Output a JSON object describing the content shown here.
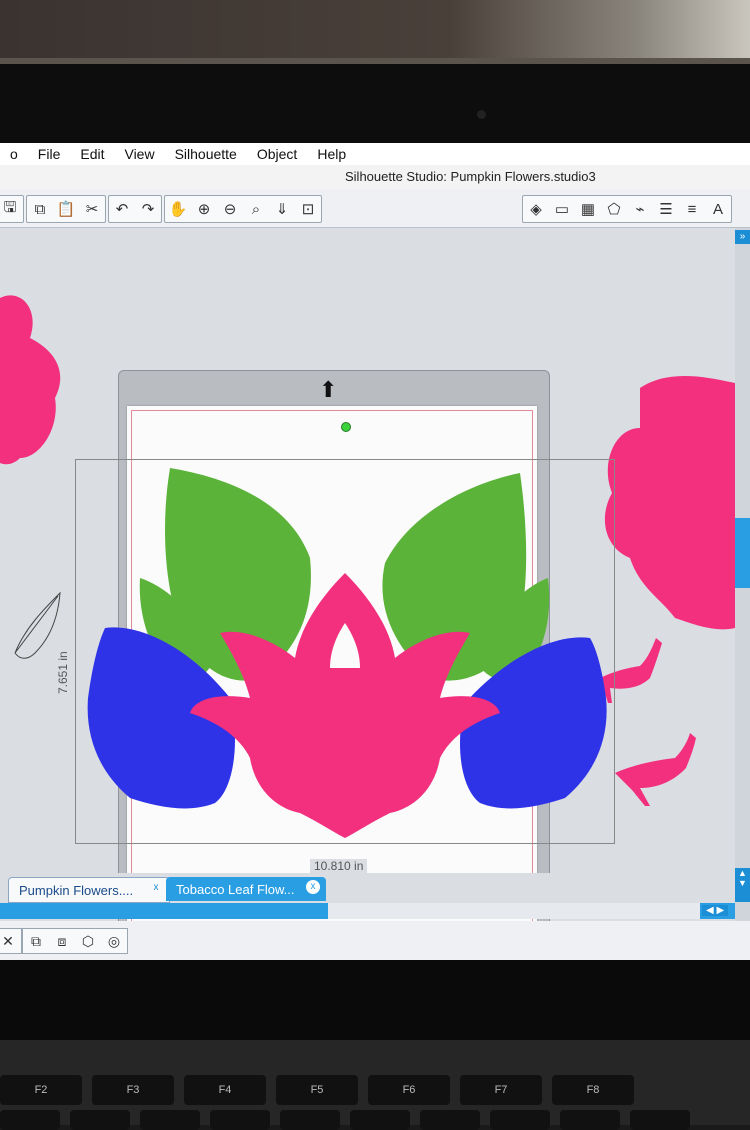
{
  "menu": [
    "o",
    "File",
    "Edit",
    "View",
    "Silhouette",
    "Object",
    "Help"
  ],
  "window_title": "Silhouette Studio: Pumpkin Flowers.studio3",
  "toolbar_left_icons": [
    "save-icon",
    "copy-icon",
    "paste-icon",
    "cut-icon",
    "undo-icon",
    "redo-icon",
    "pan-icon",
    "zoom-in-icon",
    "zoom-out-icon",
    "zoom-select-icon",
    "fit-page-icon",
    "zoom-fit-icon"
  ],
  "toolbar_left_glyphs": [
    "🖫",
    "⧉",
    "📋",
    "✂",
    "↶",
    "↷",
    "✋",
    "⊕",
    "⊖",
    "⌕",
    "⇓",
    "⊡"
  ],
  "toolbar_right_icons": [
    "fill-icon",
    "page-setup-icon",
    "grid-icon",
    "shapes-icon",
    "trace-icon",
    "line-color-icon",
    "line-style-icon",
    "text-icon"
  ],
  "toolbar_right_glyphs": [
    "◈",
    "▭",
    "▦",
    "⬠",
    "⌁",
    "☰",
    "≡",
    "A"
  ],
  "canvas": {
    "dimension_width": "10.810 in",
    "dimension_height": "7.651 in",
    "mat_brand": "silhouette",
    "colors": {
      "green": "#5cb33a",
      "blue": "#2f33e8",
      "pink": "#f2307e"
    }
  },
  "tabs": [
    {
      "label": "Pumpkin Flowers....",
      "close": "x"
    },
    {
      "label": "Tobacco Leaf Flow...",
      "close": "x"
    }
  ],
  "bottom_tools": [
    "close-icon",
    "group-icon",
    "ungroup-icon",
    "shape-icon",
    "offset-icon"
  ],
  "bottom_glyphs": [
    "✕",
    "⧉",
    "⧈",
    "⬡",
    "◎"
  ],
  "keyboard_labels": [
    "F2",
    "F3",
    "F4",
    "F5",
    "F6",
    "F7",
    "F8"
  ]
}
